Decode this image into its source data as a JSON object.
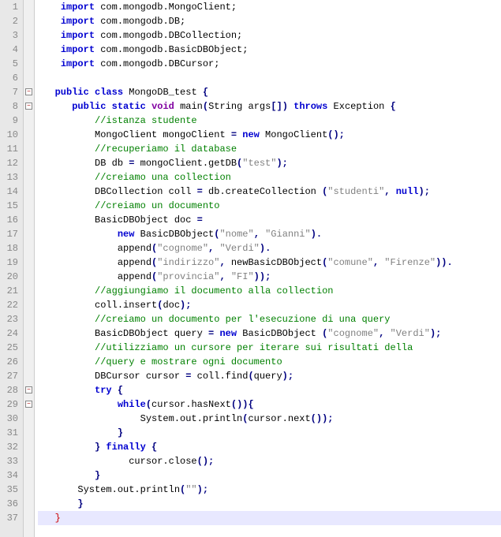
{
  "lines": [
    {
      "n": 1,
      "tokens": [
        [
          "    ",
          "p"
        ],
        [
          "import",
          "kw"
        ],
        [
          " com.mongodb.MongoClient;",
          "id"
        ]
      ]
    },
    {
      "n": 2,
      "tokens": [
        [
          "    ",
          "p"
        ],
        [
          "import",
          "kw"
        ],
        [
          " com.mongodb.DB;",
          "id"
        ]
      ]
    },
    {
      "n": 3,
      "tokens": [
        [
          "    ",
          "p"
        ],
        [
          "import",
          "kw"
        ],
        [
          " com.mongodb.DBCollection;",
          "id"
        ]
      ]
    },
    {
      "n": 4,
      "tokens": [
        [
          "    ",
          "p"
        ],
        [
          "import",
          "kw"
        ],
        [
          " com.mongodb.BasicDBObject;",
          "id"
        ]
      ]
    },
    {
      "n": 5,
      "tokens": [
        [
          "    ",
          "p"
        ],
        [
          "import",
          "kw"
        ],
        [
          " com.mongodb.DBCursor;",
          "id"
        ]
      ]
    },
    {
      "n": 6,
      "tokens": []
    },
    {
      "n": 7,
      "fold": true,
      "tokens": [
        [
          "   ",
          "p"
        ],
        [
          "public",
          "kw"
        ],
        [
          " ",
          "p"
        ],
        [
          "class",
          "kw"
        ],
        [
          " MongoDB_test ",
          "cls"
        ],
        [
          "{",
          "op"
        ]
      ]
    },
    {
      "n": 8,
      "fold": true,
      "tokens": [
        [
          "      ",
          "p"
        ],
        [
          "public",
          "kw"
        ],
        [
          " ",
          "p"
        ],
        [
          "static",
          "kw"
        ],
        [
          " ",
          "p"
        ],
        [
          "void",
          "kw2"
        ],
        [
          " main",
          "id"
        ],
        [
          "(",
          "op"
        ],
        [
          "String args",
          "id"
        ],
        [
          "[])",
          "op"
        ],
        [
          " ",
          "p"
        ],
        [
          "throws",
          "kw"
        ],
        [
          " Exception ",
          "id"
        ],
        [
          "{",
          "op"
        ]
      ]
    },
    {
      "n": 9,
      "tokens": [
        [
          "          ",
          "p"
        ],
        [
          "//istanza studente",
          "cmt"
        ]
      ]
    },
    {
      "n": 10,
      "tokens": [
        [
          "          MongoClient mongoClient ",
          "id"
        ],
        [
          "=",
          "op"
        ],
        [
          " ",
          "p"
        ],
        [
          "new",
          "kw"
        ],
        [
          " MongoClient",
          "id"
        ],
        [
          "();",
          "op"
        ]
      ]
    },
    {
      "n": 11,
      "tokens": [
        [
          "          ",
          "p"
        ],
        [
          "//recuperiamo il database",
          "cmt"
        ]
      ]
    },
    {
      "n": 12,
      "tokens": [
        [
          "          DB db ",
          "id"
        ],
        [
          "=",
          "op"
        ],
        [
          " mongoClient.getDB",
          "id"
        ],
        [
          "(",
          "op"
        ],
        [
          "\"test\"",
          "str"
        ],
        [
          ");",
          "op"
        ]
      ]
    },
    {
      "n": 13,
      "tokens": [
        [
          "          ",
          "p"
        ],
        [
          "//creiamo una collection",
          "cmt"
        ]
      ]
    },
    {
      "n": 14,
      "tokens": [
        [
          "          DBCollection coll ",
          "id"
        ],
        [
          "=",
          "op"
        ],
        [
          " db.createCollection ",
          "id"
        ],
        [
          "(",
          "op"
        ],
        [
          "\"studenti\"",
          "str"
        ],
        [
          ", ",
          "op"
        ],
        [
          "null",
          "kw"
        ],
        [
          ");",
          "op"
        ]
      ]
    },
    {
      "n": 15,
      "tokens": [
        [
          "          ",
          "p"
        ],
        [
          "//creiamo un documento",
          "cmt"
        ]
      ]
    },
    {
      "n": 16,
      "tokens": [
        [
          "          BasicDBObject doc ",
          "id"
        ],
        [
          "=",
          "op"
        ]
      ]
    },
    {
      "n": 17,
      "tokens": [
        [
          "              ",
          "p"
        ],
        [
          "new",
          "kw"
        ],
        [
          " BasicDBObject",
          "id"
        ],
        [
          "(",
          "op"
        ],
        [
          "\"nome\"",
          "str"
        ],
        [
          ", ",
          "op"
        ],
        [
          "\"Gianni\"",
          "str"
        ],
        [
          ").",
          "op"
        ]
      ]
    },
    {
      "n": 18,
      "tokens": [
        [
          "              append",
          "id"
        ],
        [
          "(",
          "op"
        ],
        [
          "\"cognome\"",
          "str"
        ],
        [
          ", ",
          "op"
        ],
        [
          "\"Verdi\"",
          "str"
        ],
        [
          ").",
          "op"
        ]
      ]
    },
    {
      "n": 19,
      "tokens": [
        [
          "              append",
          "id"
        ],
        [
          "(",
          "op"
        ],
        [
          "\"indirizzo\"",
          "str"
        ],
        [
          ", ",
          "op"
        ],
        [
          "newBasicDBObject",
          "id"
        ],
        [
          "(",
          "op"
        ],
        [
          "\"comune\"",
          "str"
        ],
        [
          ", ",
          "op"
        ],
        [
          "\"Firenze\"",
          "str"
        ],
        [
          ")).",
          "op"
        ]
      ]
    },
    {
      "n": 20,
      "tokens": [
        [
          "              append",
          "id"
        ],
        [
          "(",
          "op"
        ],
        [
          "\"provincia\"",
          "str"
        ],
        [
          ", ",
          "op"
        ],
        [
          "\"FI\"",
          "str"
        ],
        [
          "));",
          "op"
        ]
      ]
    },
    {
      "n": 21,
      "tokens": [
        [
          "          ",
          "p"
        ],
        [
          "//aggiungiamo il documento alla collection",
          "cmt"
        ]
      ]
    },
    {
      "n": 22,
      "tokens": [
        [
          "          coll.insert",
          "id"
        ],
        [
          "(",
          "op"
        ],
        [
          "doc",
          "id"
        ],
        [
          ");",
          "op"
        ]
      ]
    },
    {
      "n": 23,
      "tokens": [
        [
          "          ",
          "p"
        ],
        [
          "//creiamo un documento per l'esecuzione di una query",
          "cmt"
        ]
      ]
    },
    {
      "n": 24,
      "tokens": [
        [
          "          BasicDBObject query ",
          "id"
        ],
        [
          "=",
          "op"
        ],
        [
          " ",
          "p"
        ],
        [
          "new",
          "kw"
        ],
        [
          " BasicDBObject ",
          "id"
        ],
        [
          "(",
          "op"
        ],
        [
          "\"cognome\"",
          "str"
        ],
        [
          ", ",
          "op"
        ],
        [
          "\"Verdi\"",
          "str"
        ],
        [
          ");",
          "op"
        ]
      ]
    },
    {
      "n": 25,
      "tokens": [
        [
          "          ",
          "p"
        ],
        [
          "//utilizziamo un cursore per iterare sui risultati della",
          "cmt"
        ]
      ]
    },
    {
      "n": 26,
      "tokens": [
        [
          "          ",
          "p"
        ],
        [
          "//query e mostrare ogni documento",
          "cmt"
        ]
      ]
    },
    {
      "n": 27,
      "tokens": [
        [
          "          DBCursor cursor ",
          "id"
        ],
        [
          "=",
          "op"
        ],
        [
          " coll.find",
          "id"
        ],
        [
          "(",
          "op"
        ],
        [
          "query",
          "id"
        ],
        [
          ");",
          "op"
        ]
      ]
    },
    {
      "n": 28,
      "fold": true,
      "tokens": [
        [
          "          ",
          "p"
        ],
        [
          "try",
          "kw"
        ],
        [
          " ",
          "p"
        ],
        [
          "{",
          "op"
        ]
      ]
    },
    {
      "n": 29,
      "fold": true,
      "tokens": [
        [
          "              ",
          "p"
        ],
        [
          "while",
          "kw"
        ],
        [
          "(",
          "op"
        ],
        [
          "cursor.hasNext",
          "id"
        ],
        [
          "()){",
          "op"
        ]
      ]
    },
    {
      "n": 30,
      "tokens": [
        [
          "                  System.out.println",
          "id"
        ],
        [
          "(",
          "op"
        ],
        [
          "cursor.next",
          "id"
        ],
        [
          "());",
          "op"
        ]
      ]
    },
    {
      "n": 31,
      "tokens": [
        [
          "              ",
          "p"
        ],
        [
          "}",
          "op"
        ]
      ]
    },
    {
      "n": 32,
      "tokens": [
        [
          "          ",
          "p"
        ],
        [
          "}",
          "op"
        ],
        [
          " ",
          "p"
        ],
        [
          "finally",
          "kw"
        ],
        [
          " ",
          "p"
        ],
        [
          "{",
          "op"
        ]
      ]
    },
    {
      "n": 33,
      "tokens": [
        [
          "                cursor.close",
          "id"
        ],
        [
          "();",
          "op"
        ]
      ]
    },
    {
      "n": 34,
      "tokens": [
        [
          "          ",
          "p"
        ],
        [
          "}",
          "op"
        ]
      ]
    },
    {
      "n": 35,
      "tokens": [
        [
          "       System.out.println",
          "id"
        ],
        [
          "(",
          "op"
        ],
        [
          "\"\"",
          "str"
        ],
        [
          ");",
          "op"
        ]
      ]
    },
    {
      "n": 36,
      "tokens": [
        [
          "       ",
          "p"
        ],
        [
          "}",
          "op"
        ]
      ]
    },
    {
      "n": 37,
      "current": true,
      "tokens": [
        [
          "   ",
          "p"
        ],
        [
          "}",
          "br"
        ]
      ]
    }
  ]
}
